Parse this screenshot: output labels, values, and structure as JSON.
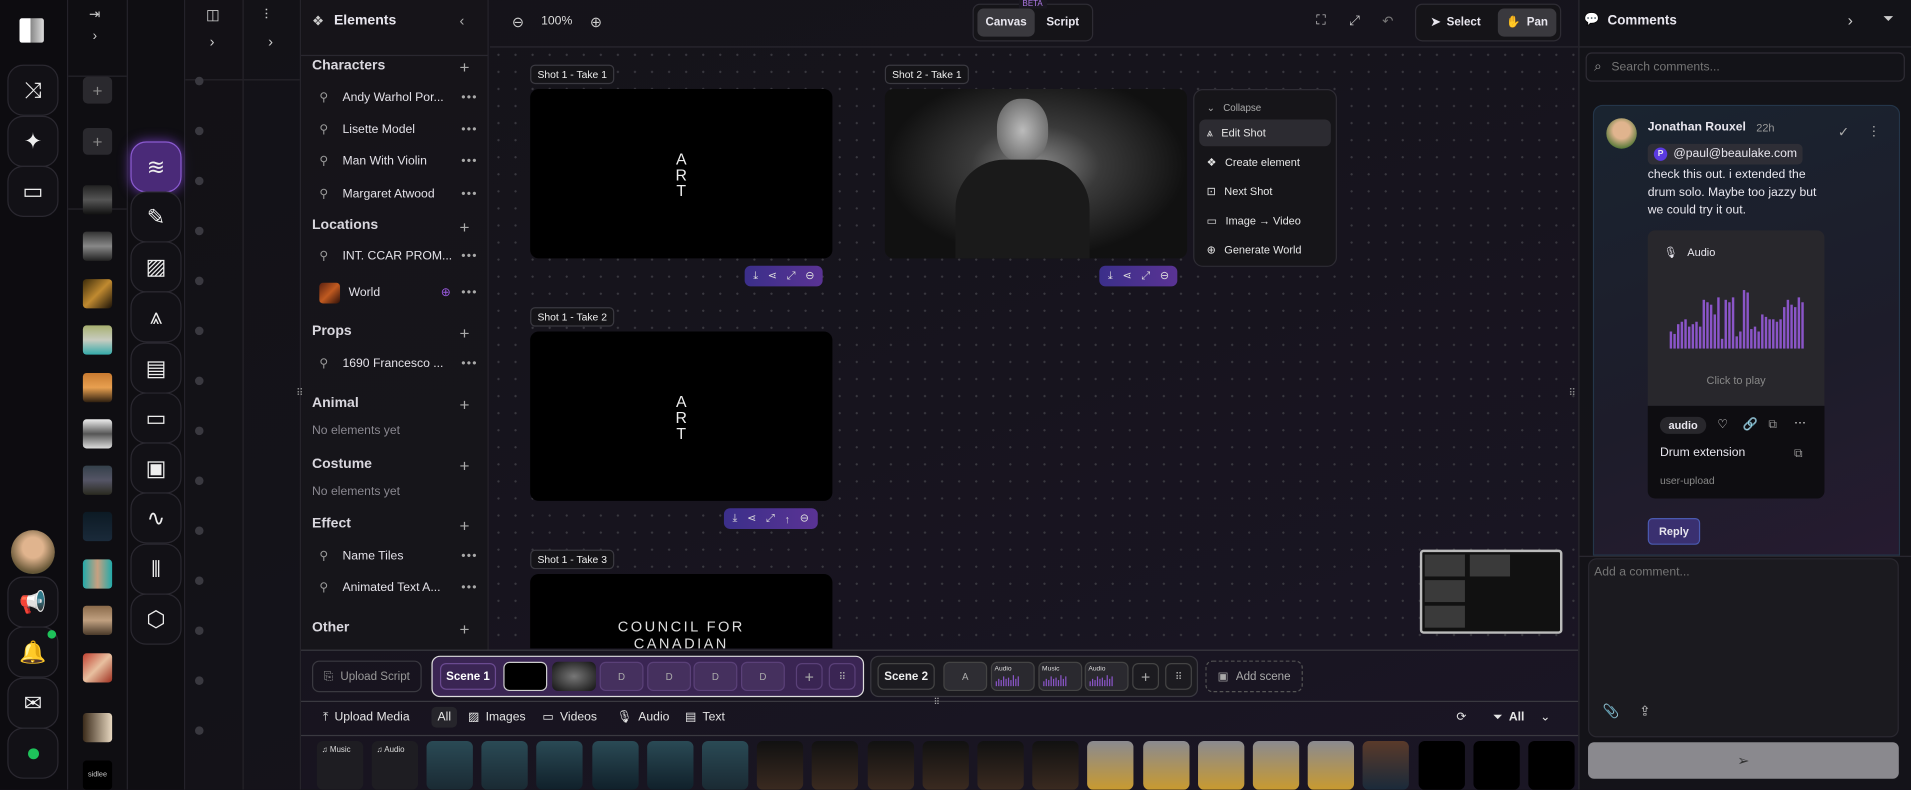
{
  "elements_panel": {
    "title": "Elements",
    "sections": [
      {
        "title": "Characters",
        "items": [
          "Andy Warhol Por...",
          "Lisette Model",
          "Man With Violin",
          "Margaret Atwood"
        ]
      },
      {
        "title": "Locations",
        "items": [
          "INT. CCAR PROM...",
          "World"
        ]
      },
      {
        "title": "Props",
        "items": [
          "1690 Francesco ..."
        ]
      },
      {
        "title": "Animal",
        "empty": "No elements yet"
      },
      {
        "title": "Costume",
        "empty": "No elements yet"
      },
      {
        "title": "Effect",
        "items": [
          "Name Tiles",
          "Animated Text A..."
        ]
      },
      {
        "title": "Other"
      }
    ]
  },
  "toolbar": {
    "zoom": "100%",
    "view_tabs": [
      "Canvas",
      "Script"
    ],
    "active_view": "Canvas",
    "beta": "BETA",
    "select": "Select",
    "pan": "Pan",
    "active_tool": "Pan"
  },
  "canvas": {
    "shots": [
      {
        "label": "Shot 1 - Take 1",
        "text": [
          "A",
          "R",
          "T"
        ]
      },
      {
        "label": "Shot 2 - Take 1"
      },
      {
        "label": "Shot 1 - Take 2",
        "text": [
          "A",
          "R",
          "T"
        ]
      },
      {
        "label": "Shot 1 - Take 3",
        "text": [
          "COUNCIL FOR",
          "CANADIAN"
        ]
      }
    ],
    "context_menu": {
      "collapse": "Collapse",
      "items": [
        "Edit Shot",
        "Create element",
        "Next Shot",
        "Image → Video",
        "Generate World"
      ]
    }
  },
  "scenes": {
    "upload_script": "Upload Script",
    "scene1": "Scene 1",
    "scene1_placeholders": [
      "D",
      "D",
      "D",
      "D"
    ],
    "scene2": "Scene 2",
    "scene2_placeholder": "A",
    "scene2_audio": [
      "Audio",
      "Music",
      "Audio"
    ],
    "add_scene": "Add scene"
  },
  "media": {
    "upload": "Upload Media",
    "tabs": [
      "All",
      "Images",
      "Videos",
      "Audio",
      "Text"
    ],
    "active_tab": "All",
    "filter": "All",
    "audio_items": [
      "Music",
      "Audio"
    ],
    "text_thumb": "sidlee"
  },
  "comments": {
    "title": "Comments",
    "search_placeholder": "Search comments...",
    "comment": {
      "author": "Jonathan Rouxel",
      "time": "22h",
      "mention_initial": "P",
      "mention": "@paul@beaulake.com",
      "text": "check this out. i extended the drum solo. Maybe too jazzy but we could try it out.",
      "attachment": {
        "type_label": "Audio",
        "play_hint": "Click to play",
        "tag": "audio",
        "name": "Drum extension",
        "source": "user-upload"
      },
      "reply": "Reply"
    },
    "add_placeholder": "Add a comment..."
  },
  "colors": {
    "accent": "#7c4dcc",
    "waveform": "#8a55c8",
    "status_online": "#1ec25a"
  }
}
